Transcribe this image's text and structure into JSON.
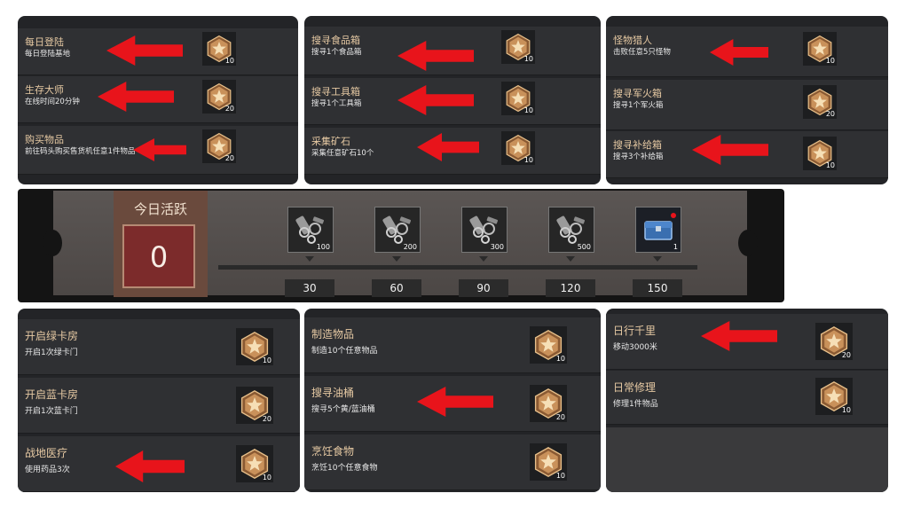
{
  "panels": [
    {
      "tasks": [
        {
          "title": "每日登陆",
          "desc": "每日登陆基地",
          "qty": "10"
        },
        {
          "title": "生存大师",
          "desc": "在线时间20分钟",
          "qty": "20"
        },
        {
          "title": "购买物品",
          "desc": "前往码头购买售货机任意1件物品",
          "qty": "20"
        }
      ]
    },
    {
      "tasks": [
        {
          "title": "搜寻食品箱",
          "desc": "搜寻1个食品箱",
          "qty": "10"
        },
        {
          "title": "搜寻工具箱",
          "desc": "搜寻1个工具箱",
          "qty": "10"
        },
        {
          "title": "采集矿石",
          "desc": "采集任意矿石10个",
          "qty": "10"
        }
      ]
    },
    {
      "tasks": [
        {
          "title": "怪物猎人",
          "desc": "击败任意5只怪物",
          "qty": "10"
        },
        {
          "title": "搜寻军火箱",
          "desc": "搜寻1个军火箱",
          "qty": "20"
        },
        {
          "title": "搜寻补给箱",
          "desc": "搜寻3个补给箱",
          "qty": "10"
        }
      ]
    },
    {
      "tasks": [
        {
          "title": "开启绿卡房",
          "desc": "开启1次绿卡门",
          "qty": "10"
        },
        {
          "title": "开启蓝卡房",
          "desc": "开启1次蓝卡门",
          "qty": "20"
        },
        {
          "title": "战地医疗",
          "desc": "使用药品3次",
          "qty": "10"
        }
      ]
    },
    {
      "tasks": [
        {
          "title": "制造物品",
          "desc": "制造10个任意物品",
          "qty": "10"
        },
        {
          "title": "搜寻油桶",
          "desc": "搜寻5个黄/蓝油桶",
          "qty": "20"
        },
        {
          "title": "烹饪食物",
          "desc": "烹饪10个任意食物",
          "qty": "10"
        }
      ]
    },
    {
      "tasks": [
        {
          "title": "日行千里",
          "desc": "移动3000米",
          "qty": "20"
        },
        {
          "title": "日常修理",
          "desc": "修理1件物品",
          "qty": "10"
        }
      ]
    }
  ],
  "activity": {
    "label": "今日活跃",
    "value": "0",
    "milestones": [
      {
        "threshold": "30",
        "reward_qty": "100",
        "icon": "scrap-parts-icon"
      },
      {
        "threshold": "60",
        "reward_qty": "200",
        "icon": "scrap-parts-icon"
      },
      {
        "threshold": "90",
        "reward_qty": "300",
        "icon": "scrap-parts-icon"
      },
      {
        "threshold": "120",
        "reward_qty": "500",
        "icon": "scrap-parts-icon"
      },
      {
        "threshold": "150",
        "reward_qty": "1",
        "icon": "blue-chest-icon"
      }
    ]
  },
  "colors": {
    "arrow": "#e8141b",
    "title": "#e6c9a3",
    "medal": "#c9915a"
  }
}
